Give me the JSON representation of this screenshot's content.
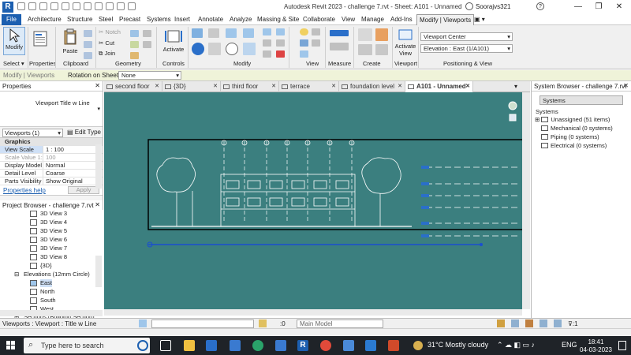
{
  "window": {
    "title": "Autodesk Revit 2023 - challenge 7.rvt - Sheet: A101 - Unnamed",
    "user": "Soorajvs321",
    "help": "?"
  },
  "ribbon_tabs": [
    "File",
    "Architecture",
    "Structure",
    "Steel",
    "Precast",
    "Systems",
    "Insert",
    "Annotate",
    "Analyze",
    "Massing & Site",
    "Collaborate",
    "View",
    "Manage",
    "Add-Ins",
    "Modify | Viewports"
  ],
  "ribbon": {
    "modify": "Modify",
    "select": "Select ▾",
    "properties": "Properties",
    "paste": "Paste",
    "clipboard": "Clipboard",
    "cut": "Cut",
    "join": "Join",
    "notch": "Notch",
    "geometry": "Geometry",
    "activate": "Activate",
    "controls": "Controls",
    "modify_panel": "Modify",
    "view": "View",
    "measure": "Measure",
    "create": "Create",
    "activate_view": "Activate View",
    "viewport": "Viewport",
    "viewport_center": "Viewport Center",
    "elevation_east": "Elevation : East (1/A101)",
    "positioning": "Positioning & View"
  },
  "optionsbar": {
    "context": "Modify | Viewports",
    "rotation_label": "Rotation on Sheet:",
    "rotation_value": "None"
  },
  "properties": {
    "title": "Properties",
    "type_name": "Viewport Title w Line",
    "selector": "Viewports (1)",
    "edit_type": "Edit Type",
    "graphics": "Graphics",
    "rows": [
      {
        "k": "View Scale",
        "v": "1 : 100"
      },
      {
        "k": "Scale Value 1:",
        "v": "100"
      },
      {
        "k": "Display Model",
        "v": "Normal"
      },
      {
        "k": "Detail Level",
        "v": "Coarse"
      },
      {
        "k": "Parts Visibility",
        "v": "Show Original"
      }
    ],
    "help": "Properties help",
    "apply": "Apply"
  },
  "project_browser": {
    "title": "Project Browser - challenge 7.rvt",
    "items": [
      "3D View 3",
      "3D View 4",
      "3D View 5",
      "3D View 6",
      "3D View 7",
      "3D View 8",
      "{3D}",
      "Elevations (12mm Circle)",
      "East",
      "North",
      "South",
      "West",
      "Sections (Building Section)"
    ]
  },
  "doc_tabs": [
    "second floor",
    "{3D}",
    "third floor",
    "terrace",
    "foundation level",
    "A101 - Unnamed"
  ],
  "system_browser": {
    "title": "System Browser - challenge 7.rvt",
    "filter": "Systems",
    "header": "Systems",
    "items": [
      "Unassigned (51 items)",
      "Mechanical (0 systems)",
      "Piping (0 systems)",
      "Electrical (0 systems)"
    ]
  },
  "statusbar": {
    "text": "Viewports : Viewport : Title w Line",
    "zero": ":0",
    "model": "Main Model",
    "filter": ":1"
  },
  "taskbar": {
    "search": "Type here to search",
    "weather": "31°C  Mostly cloudy",
    "lang": "ENG",
    "time": "18:41",
    "date": "04-03-2023"
  },
  "colors": {
    "canvas": "#3b7f7f",
    "accent": "#1c5fb0",
    "options_bar": "#eff3d9"
  }
}
